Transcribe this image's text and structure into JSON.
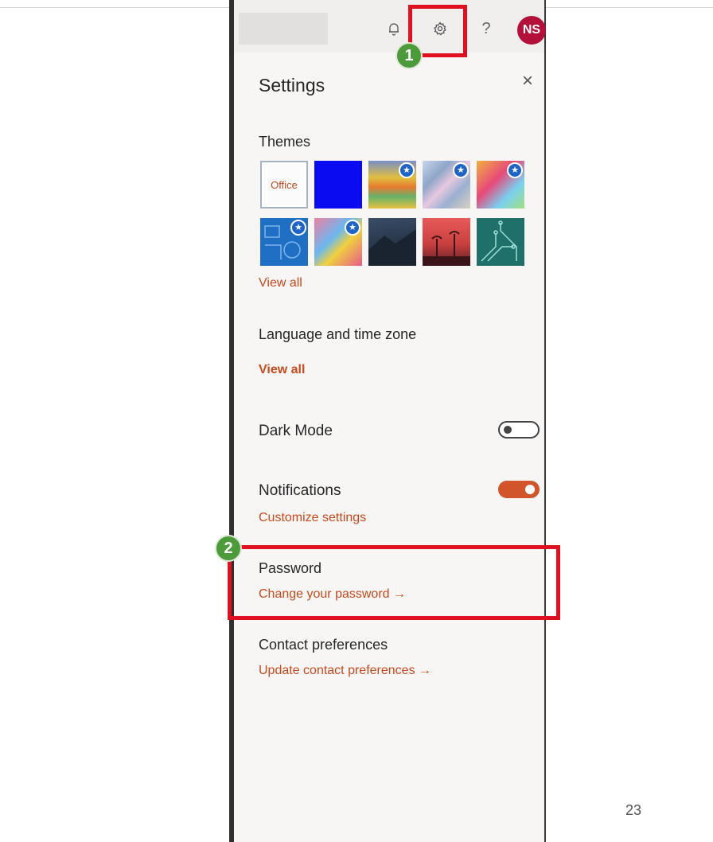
{
  "topbar": {
    "icons": [
      "bell-icon",
      "gear-icon",
      "help-icon"
    ],
    "help_glyph": "?",
    "avatar_initials": "NS"
  },
  "settings": {
    "title": "Settings",
    "close_glyph": "×",
    "themes": {
      "heading": "Themes",
      "office_label": "Office",
      "view_all": "View all"
    },
    "language": {
      "heading": "Language and time zone",
      "view_all": "View all"
    },
    "dark_mode": {
      "label": "Dark Mode",
      "enabled": false
    },
    "notifications": {
      "label": "Notifications",
      "enabled": true,
      "link": "Customize settings"
    },
    "password": {
      "heading": "Password",
      "link": "Change your password →"
    },
    "contact": {
      "heading": "Contact preferences",
      "link": "Update contact preferences →"
    }
  },
  "annotations": {
    "step1": "1",
    "step2": "2"
  },
  "page_number": "23",
  "colors": {
    "accent": "#c8491e",
    "avatar": "#b3103a",
    "highlight": "#e01020",
    "badge": "#4c9a3a"
  }
}
